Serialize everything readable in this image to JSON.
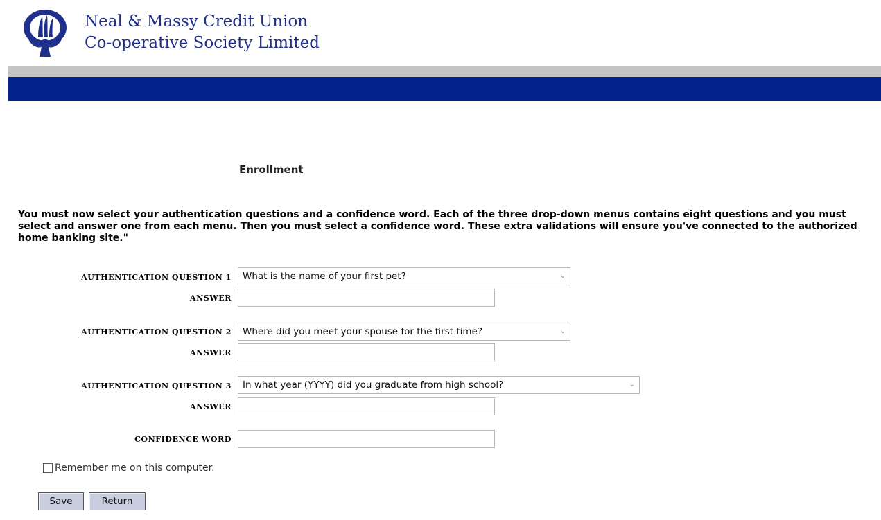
{
  "header": {
    "org_line1": "Neal & Massy Credit Union",
    "org_line2": "Co-operative Society Limited",
    "logo_icon": "credit-union-logo-icon",
    "brand_color": "#02228c"
  },
  "page": {
    "title": "Enrollment",
    "instructions": "You must now select your authentication questions and a confidence word. Each of the three drop-down menus contains eight questions and you must select and answer one from each menu. Then you must select a confidence word. These extra validations will ensure you've connected to the authorized home banking site.\""
  },
  "form": {
    "q1_label": "AUTHENTICATION QUESTION 1",
    "q1_value": "What is the name of your first pet?",
    "q2_label": "AUTHENTICATION QUESTION 2",
    "q2_value": "Where did you meet your spouse for the first time?",
    "q3_label": "AUTHENTICATION QUESTION 3",
    "q3_value": "In what year (YYYY) did you graduate from high school?",
    "answer_label": "ANSWER",
    "confidence_label": "CONFIDENCE WORD",
    "answer1_value": "",
    "answer2_value": "",
    "answer3_value": "",
    "confidence_value": "",
    "remember_label": "Remember me on this computer.",
    "remember_checked": false
  },
  "buttons": {
    "save": "Save",
    "return": "Return"
  }
}
